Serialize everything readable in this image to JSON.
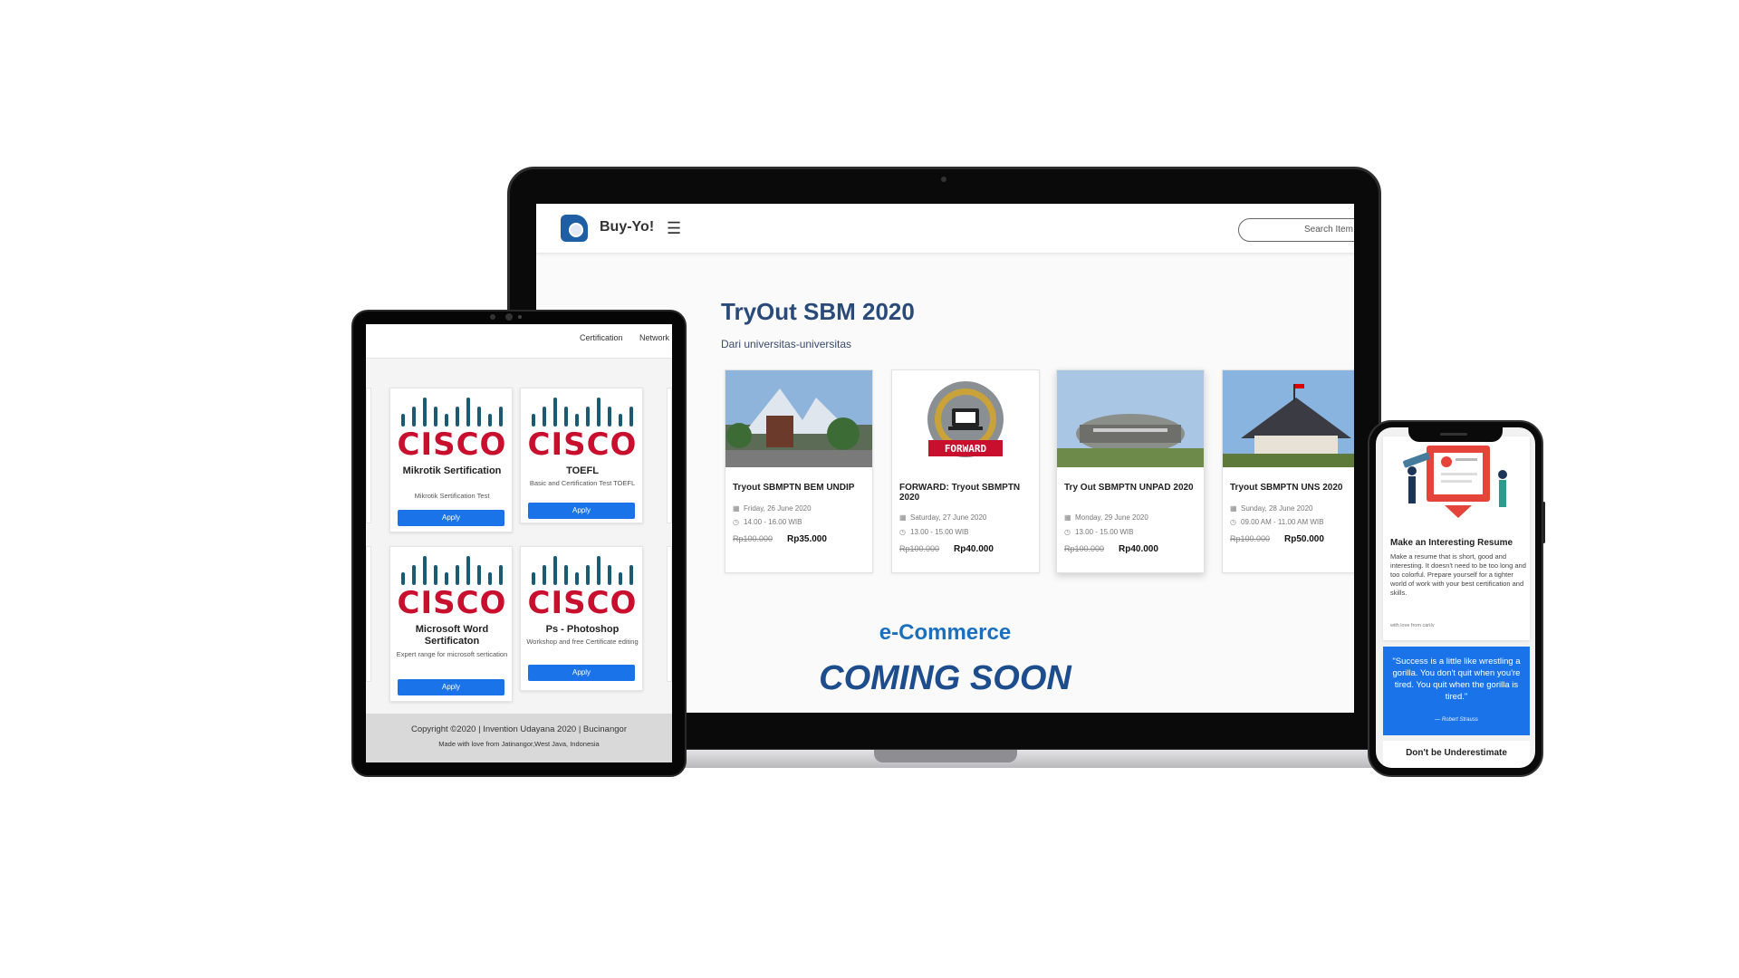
{
  "laptop": {
    "brand": "Buy-Yo!",
    "menu_icon": "hamburger-icon",
    "search_placeholder": "Search Item",
    "section_title": "TryOut SBM 2020",
    "section_subtitle": "Dari universitas-universitas",
    "cards": [
      {
        "title": "Tryout SBMPTN BEM UNDIP",
        "date": "Friday, 26 June 2020",
        "time": "14.00 - 16.00 WIB",
        "old_price": "Rp100.000",
        "price": "Rp35.000"
      },
      {
        "title": "FORWARD: Tryout SBMPTN 2020",
        "date": "Saturday, 27 June 2020",
        "time": "13.00 - 15.00 WIB",
        "old_price": "Rp100.000",
        "price": "Rp40.000",
        "logo_text": "FORWARD"
      },
      {
        "title": "Try Out SBMPTN UNPAD 2020",
        "date": "Monday, 29 June 2020",
        "time": "13.00 - 15.00 WIB",
        "old_price": "Rp100.000",
        "price": "Rp40.000"
      },
      {
        "title": "Tryout SBMPTN UNS 2020",
        "date": "Sunday, 28 June 2020",
        "time": "09.00 AM - 11.00 AM WIB",
        "old_price": "Rp100.000",
        "price": "Rp50.000"
      }
    ],
    "ecommerce": "e-Commerce",
    "coming_soon": "COMING SOON"
  },
  "tablet": {
    "nav": [
      "Certification",
      "Network"
    ],
    "logo_text": "CISCO",
    "cards": [
      {
        "name": "Mikrotik Sertification",
        "desc": "Mikrotik Sertification Test",
        "apply": "Apply"
      },
      {
        "name": "TOEFL",
        "desc": "Basic and Certification Test TOEFL",
        "apply": "Apply"
      },
      {
        "name": "Microsoft Word Sertificaton",
        "desc": "Expert range for microsoft sertication",
        "apply": "Apply"
      },
      {
        "name": "Ps - Photoshop",
        "desc": "Workshop and free Certificate editing",
        "apply": "Apply"
      }
    ],
    "footer": {
      "copyright": "Copyright ©2020 | Invention Udayana 2020 | Bucinangor",
      "made_with": "Made with love from Jatinangor,West Java, Indonesia"
    }
  },
  "phone": {
    "card_title": "Make an Interesting Resume",
    "card_text": "Make a resume that is short, good and interesting. It doesn't need to be too long and too colorful. Prepare yourself for a tighter world of work with your best certification and skills.",
    "card_love": "with love from cariIv",
    "quote": "\"Success is a little like wrestling a gorilla. You don't quit when you're tired. You quit when the gorilla is tired.\"",
    "quote_author": "— Robert Strauss",
    "next_title": "Don't be Underestimate"
  },
  "colors": {
    "accent_blue": "#1a73e8",
    "title_navy": "#2a4a7a",
    "cisco_red": "#c8102e",
    "cisco_teal": "#1b5a73"
  }
}
